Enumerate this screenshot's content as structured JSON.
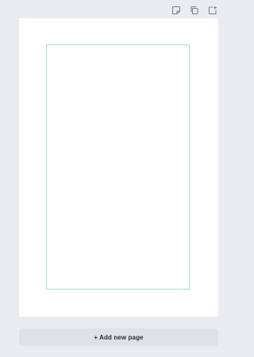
{
  "toolbar": {
    "icons": [
      "add-note-icon",
      "duplicate-page-icon",
      "add-page-icon"
    ],
    "icon_color": "#7b8089"
  },
  "page": {
    "background": "#ffffff",
    "guide_color": "#9fdedb"
  },
  "add_page_label": "+ Add new page",
  "colors": {
    "workspace": "#ebecf0",
    "button_bg": "#dfe1e6",
    "button_text": "#2c3037"
  }
}
